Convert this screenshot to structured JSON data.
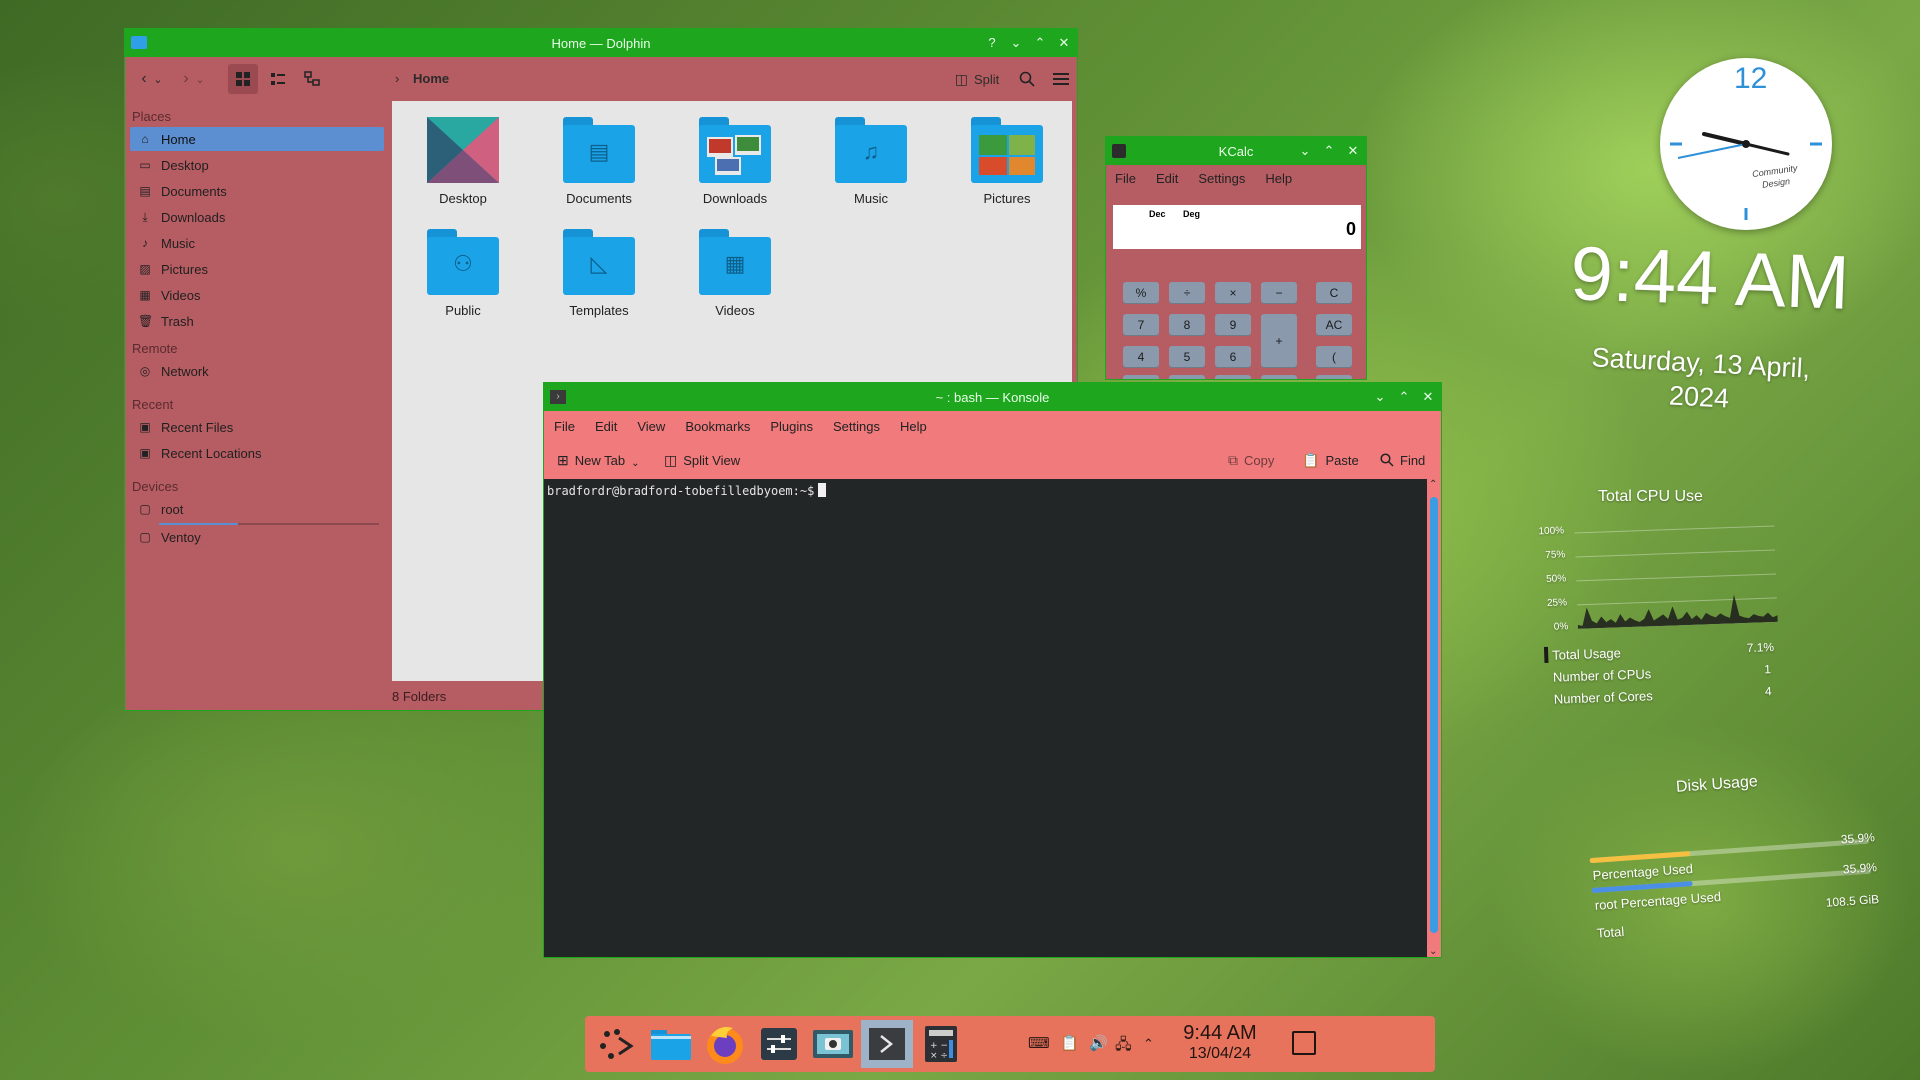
{
  "dolphin": {
    "title": "Home — Dolphin",
    "breadcrumb": "Home",
    "split_label": "Split",
    "status": "8 Folders",
    "places_heading": "Places",
    "places": [
      "Home",
      "Desktop",
      "Documents",
      "Downloads",
      "Music",
      "Pictures",
      "Videos",
      "Trash"
    ],
    "remote_heading": "Remote",
    "remote": [
      "Network"
    ],
    "recent_heading": "Recent",
    "recent": [
      "Recent Files",
      "Recent Locations"
    ],
    "devices_heading": "Devices",
    "devices": [
      "root",
      "Ventoy"
    ],
    "root_usage_fraction": 0.36,
    "folders": [
      "Desktop",
      "Documents",
      "Downloads",
      "Music",
      "Pictures",
      "Public",
      "Templates",
      "Videos"
    ]
  },
  "kcalc": {
    "title": "KCalc",
    "menu": [
      "File",
      "Edit",
      "Settings",
      "Help"
    ],
    "mode_dec": "Dec",
    "mode_deg": "Deg",
    "display_value": "0",
    "buttons": [
      "%",
      "÷",
      "×",
      "−",
      "C",
      "7",
      "8",
      "9",
      "+",
      "AC",
      "4",
      "5",
      "6",
      "("
    ]
  },
  "konsole": {
    "title": "~ : bash — Konsole",
    "menu": [
      "File",
      "Edit",
      "View",
      "Bookmarks",
      "Plugins",
      "Settings",
      "Help"
    ],
    "new_tab": "New Tab",
    "split_view": "Split View",
    "copy": "Copy",
    "paste": "Paste",
    "find": "Find",
    "prompt": "bradfordr@bradford-tobefilledbyoem:~$"
  },
  "clock": {
    "time": "9:44 AM",
    "date_line1": "Saturday, 13 April,",
    "date_line2": "2024",
    "dial_twelve": "12",
    "dial_caption_1": "Community",
    "dial_caption_2": "Design"
  },
  "cpu": {
    "title": "Total CPU Use",
    "ticks": [
      "100%",
      "75%",
      "50%",
      "25%",
      "0%"
    ],
    "rows": [
      {
        "label": "Total Usage",
        "value": "7.1%"
      },
      {
        "label": "Number of CPUs",
        "value": "1"
      },
      {
        "label": "Number of Cores",
        "value": "4"
      }
    ],
    "history": [
      4,
      3,
      22,
      8,
      5,
      12,
      6,
      9,
      5,
      14,
      6,
      10,
      7,
      5,
      8,
      18,
      6,
      9,
      12,
      7,
      20,
      6,
      8,
      14,
      6,
      10,
      5,
      12,
      9,
      7,
      11,
      8,
      6,
      30,
      8,
      6,
      5,
      9,
      7,
      6,
      10,
      5,
      7
    ]
  },
  "disk": {
    "title": "Disk Usage",
    "rows": [
      {
        "label": "Percentage Used",
        "value": "35.9%",
        "fraction": 0.359,
        "color": "#f5c042"
      },
      {
        "label": "root Percentage Used",
        "value": "35.9%",
        "fraction": 0.359,
        "color": "#4a8ee6"
      },
      {
        "label": "Total",
        "value": "108.5 GiB"
      }
    ]
  },
  "taskbar": {
    "time": "9:44 AM",
    "date": "13/04/24",
    "apps": [
      "app-launcher",
      "dolphin",
      "firefox",
      "system-settings",
      "spectacle",
      "konsole",
      "kcalc"
    ],
    "active_app": "konsole"
  }
}
